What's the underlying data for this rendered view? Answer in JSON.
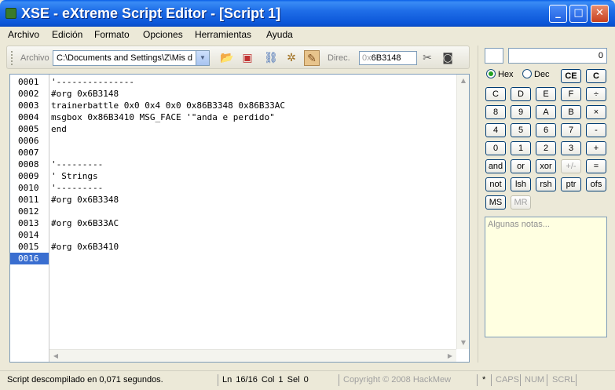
{
  "window": {
    "title": "XSE - eXtreme Script Editor - [Script 1]",
    "minimize": "_",
    "maximize": "□",
    "close": "✕"
  },
  "menu": [
    "Archivo",
    "Edición",
    "Formato",
    "Opciones",
    "Herramientas",
    "Ayuda"
  ],
  "toolbar": {
    "file_label": "Archivo",
    "file_path": "C:\\Documents and Settings\\Z\\Mis d",
    "address_label": "Direc.",
    "address_prefix": "0x",
    "address_value": "6B3148",
    "icons": [
      "open-icon",
      "save-icon",
      "link-icon",
      "compile-icon",
      "script-icon",
      "cut-icon",
      "stop-icon"
    ]
  },
  "editor": {
    "line_numbers": [
      "0001",
      "0002",
      "0003",
      "0004",
      "0005",
      "0006",
      "0007",
      "0008",
      "0009",
      "0010",
      "0011",
      "0012",
      "0013",
      "0014",
      "0015",
      "0016"
    ],
    "current_line": "0016",
    "lines": [
      "'---------------",
      "#org 0x6B3148",
      "trainerbattle 0x0 0x4 0x0 0x86B3348 0x86B33AC",
      "msgbox 0x86B3410 MSG_FACE '\"anda e perdido\"",
      "end",
      "",
      "",
      "'---------",
      "' Strings",
      "'---------",
      "#org 0x6B3348",
      "",
      "#org 0x6B33AC",
      "",
      "#org 0x6B3410",
      ""
    ]
  },
  "calculator": {
    "display_value": "0",
    "hex_label": "Hex",
    "dec_label": "Dec",
    "mode": "Hex",
    "rows": [
      [
        "CE",
        "C"
      ],
      [
        "C",
        "D",
        "E",
        "F",
        "÷"
      ],
      [
        "8",
        "9",
        "A",
        "B",
        "×"
      ],
      [
        "4",
        "5",
        "6",
        "7",
        "-"
      ],
      [
        "0",
        "1",
        "2",
        "3",
        "+"
      ],
      [
        "and",
        "or",
        "xor",
        "+/-",
        "="
      ],
      [
        "not",
        "lsh",
        "rsh",
        "ptr",
        "ofs"
      ],
      [
        "MS",
        "MR"
      ]
    ],
    "notes_placeholder": "Algunas notas..."
  },
  "status": {
    "message": "Script descompilado en 0,071 segundos.",
    "position": "Ln 16/16  Col 1  Sel 0",
    "copyright": "Copyright © 2008 HackMew",
    "modified": "*",
    "caps": "CAPS",
    "num": "NUM",
    "scrl": "SCRL"
  }
}
